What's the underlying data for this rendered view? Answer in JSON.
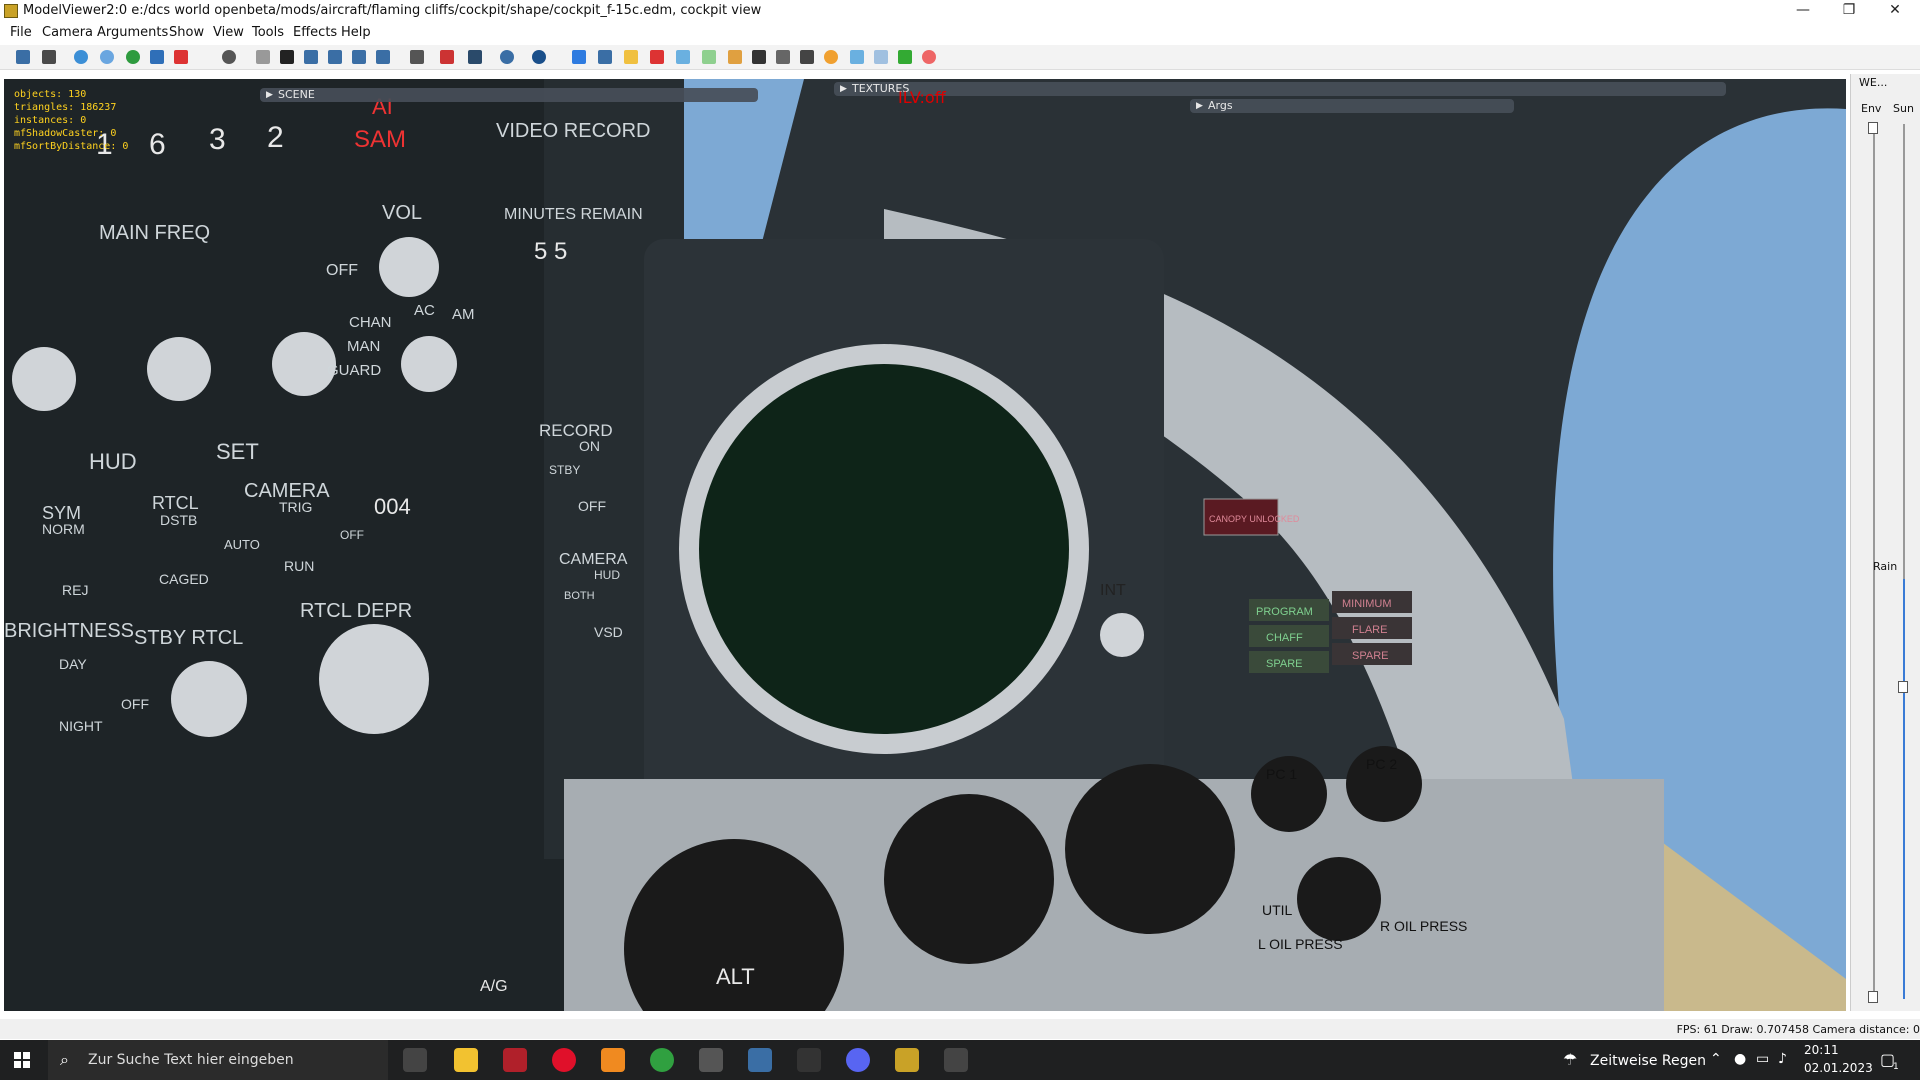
{
  "window": {
    "title": "ModelViewer2:0 e:/dcs world openbeta/mods/aircraft/flaming cliffs/cockpit/shape/cockpit_f-15c.edm, cockpit view",
    "controls": [
      "—",
      "❐",
      "✕"
    ]
  },
  "menu": [
    "File",
    "Camera",
    "Arguments",
    "Show",
    "View",
    "Tools",
    "Effects",
    "Help"
  ],
  "overlay": {
    "stats": [
      "objects: 130",
      "triangles: 186237",
      "instances: 0",
      "mfShadowCaster: 0",
      "mfSortByDistance: 0"
    ],
    "scene_label": "SCENE",
    "textures_label": "TEXTURES",
    "args_label": "Args",
    "ilv_text": "ILV:off"
  },
  "cockpit": {
    "top_digits": [
      "1",
      "6",
      "3",
      "2"
    ],
    "ai_label": "AI",
    "sam_label": "SAM",
    "video_record": "VIDEO RECORD",
    "minutes_remain": "MINUTES REMAIN",
    "minutes_value": "5 5",
    "main_freq": "MAIN FREQ",
    "vol": "VOL",
    "off": "OFF",
    "chan": "CHAN",
    "man": "MAN",
    "guard": "GUARD",
    "ac": "AC",
    "am": "AM",
    "hud": "HUD",
    "set": "SET",
    "sym": "SYM",
    "norm": "NORM",
    "rej": "REJ",
    "rtcl": "RTCL",
    "dstb": "DSTB",
    "auto": "AUTO",
    "caged": "CAGED",
    "camera": "CAMERA",
    "trig": "TRIG",
    "run": "RUN",
    "off2": "OFF",
    "counter": "004",
    "record": "RECORD",
    "on": "ON",
    "stby": "STBY",
    "off3": "OFF",
    "camera2": "CAMERA",
    "hud2": "HUD",
    "both": "BOTH",
    "vsd": "VSD",
    "brightness": "BRIGHTNESS",
    "stby_rtcl": "STBY RTCL",
    "rtcl_depr": "RTCL DEPR",
    "day": "DAY",
    "night": "NIGHT",
    "off4": "OFF",
    "int": "INT",
    "canopy": "CANOPY UNLOCKED",
    "program": "PROGRAM",
    "minimum": "MINIMUM",
    "chaff": "CHAFF",
    "flare": "FLARE",
    "spare1": "SPARE",
    "spare2": "SPARE",
    "pc1": "PC 1",
    "pc2": "PC 2",
    "util": "UTIL",
    "l_oil": "L OIL PRESS",
    "r_oil": "R OIL PRESS",
    "alt": "ALT",
    "ag": "A/G"
  },
  "right_panel": {
    "header": "WE...",
    "env": "Env",
    "sun": "Sun",
    "rain": "Rain"
  },
  "status": {
    "text": "FPS: 61  Draw: 0.707458  Camera distance: 0"
  },
  "taskbar": {
    "search_placeholder": "Zur Suche Text hier eingeben",
    "weather": "Zeitweise Regen",
    "time": "20:11",
    "date": "02.01.2023",
    "notification_count": "1"
  },
  "colors": {
    "sky": "#7da9d4",
    "panel": "#2a3136",
    "frame": "#b6bcc1",
    "hud_yellow": "#ffd21f",
    "taskbar": "#1f2021"
  }
}
